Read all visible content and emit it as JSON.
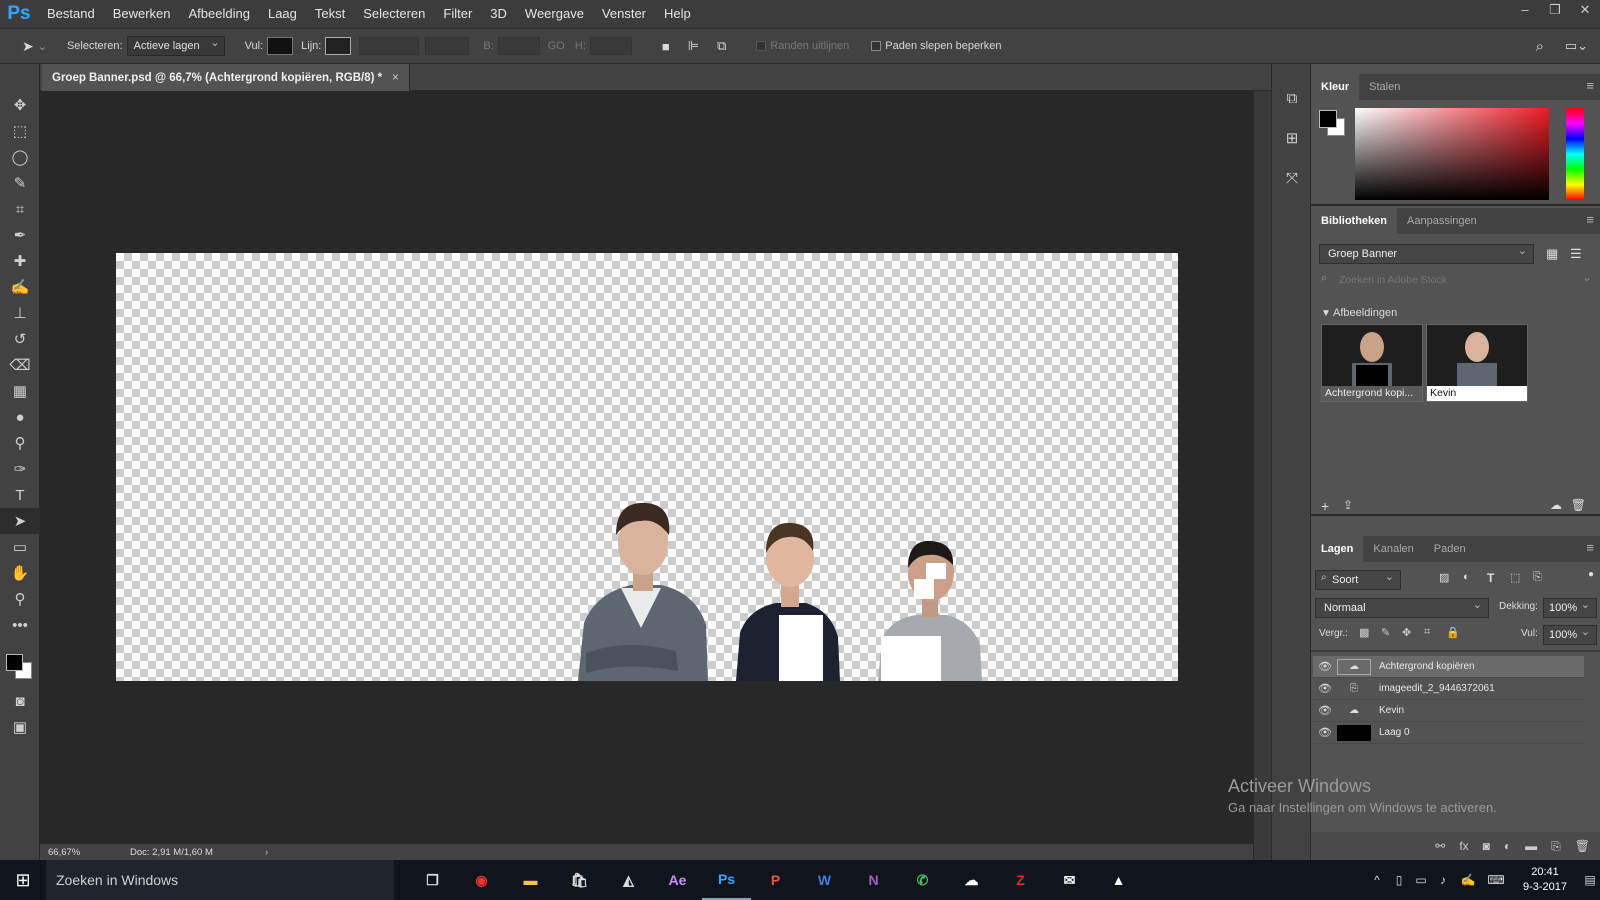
{
  "app": {
    "logo": "Ps"
  },
  "menu": [
    "Bestand",
    "Bewerken",
    "Afbeelding",
    "Laag",
    "Tekst",
    "Selecteren",
    "Filter",
    "3D",
    "Weergave",
    "Venster",
    "Help"
  ],
  "window_controls": [
    "–",
    "❐",
    "✕"
  ],
  "options": {
    "select_label": "Selecteren:",
    "select_value": "Actieve lagen",
    "fill_label": "Vul:",
    "stroke_label": "Lijn:",
    "width_label": "B:",
    "link_label": "GO",
    "height_label": "H:",
    "align_edges": "Randen uitlijnen",
    "constrain_paths": "Paden slepen beperken"
  },
  "document": {
    "tab_title": "Groep Banner.psd @ 66,7% (Achtergrond kopiëren, RGB/8) *",
    "close": "×",
    "zoom": "66,67%",
    "doc_size": "Doc: 2,91 M/1,60 M",
    "expand": "›"
  },
  "color_panel": {
    "tabs": [
      "Kleur",
      "Stalen"
    ],
    "fg": "#000000",
    "bg": "#ffffff"
  },
  "libraries_panel": {
    "tabs": [
      "Bibliotheken",
      "Aanpassingen"
    ],
    "library": "Groep Banner",
    "search_placeholder": "Zoeken in Adobe Stock",
    "section": "Afbeeldingen",
    "items": [
      "Achtergrond kopi...",
      "Kevin"
    ]
  },
  "layers_panel": {
    "tabs": [
      "Lagen",
      "Kanalen",
      "Paden"
    ],
    "filter": "Soort",
    "blend_mode": "Normaal",
    "opacity_label": "Dekking:",
    "opacity": "100%",
    "lock_label": "Vergr.:",
    "fill_label": "Vul:",
    "fill": "100%",
    "layers": [
      {
        "name": "Achtergrond kopiëren",
        "selected": true
      },
      {
        "name": "imageedit_2_9446372061",
        "selected": false
      },
      {
        "name": "Kevin",
        "selected": false
      },
      {
        "name": "Laag 0",
        "selected": false
      }
    ]
  },
  "watermark": {
    "title": "Activeer Windows",
    "subtitle": "Ga naar Instellingen om Windows te activeren."
  },
  "taskbar": {
    "search": "Zoeken in Windows",
    "apps": [
      "Ae",
      "Ps",
      "P",
      "W",
      "N",
      "Z"
    ],
    "time": "20:41",
    "date": "9-3-2017"
  }
}
